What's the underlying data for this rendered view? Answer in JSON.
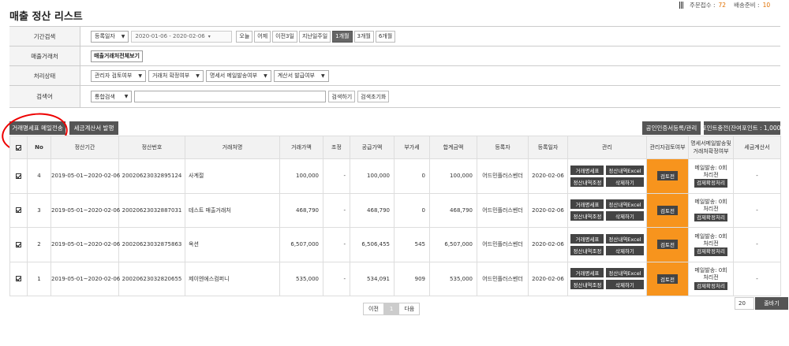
{
  "page_title": "매출 정산 리스트",
  "status": {
    "order_label": "주문접수 :",
    "order_count": "72",
    "ship_label": "배송준비 :",
    "ship_count": "10"
  },
  "search": {
    "period": {
      "label": "기간검색",
      "type_select": "등록일자",
      "date_range": "2020-01-06 - 2020-02-06",
      "quick_buttons": [
        "오늘",
        "어제",
        "이전3일",
        "지난일주일",
        "1개월",
        "3개월",
        "6개월"
      ],
      "active_quick": "1개월"
    },
    "partner": {
      "label": "매출거래처",
      "button": "매출거래처전체보기"
    },
    "status_filter": {
      "label": "처리상태",
      "selects": [
        "관리자 검토여부",
        "거래처 확정여부",
        "명세서 메일발송여부",
        "계산서 발급여부"
      ]
    },
    "keyword": {
      "label": "검색어",
      "select": "통합검색",
      "value": "",
      "search_button": "검색하기",
      "reset_button": "검색초기화"
    }
  },
  "actions": {
    "send_statement": "거래명세표 메일전송",
    "issue_invoice": "세금계산서 발행",
    "cert_register": "공인인증서등록/관리",
    "point_charge": "포인트충전(잔여포인트 : 1,000)"
  },
  "table": {
    "headers": [
      "No",
      "정산기간",
      "정산번호",
      "거래처명",
      "거래가액",
      "조정",
      "공급가액",
      "부가세",
      "합계금액",
      "등록자",
      "등록일자",
      "관리",
      "관리자검토여부",
      "명세서메일발송및 거래처확정여부",
      "세금계산서"
    ],
    "manage_buttons": [
      "거래명세표",
      "정산내역Excel",
      "정산내역조정",
      "삭제하기"
    ],
    "review_button": "검토전",
    "tax_status": "메일발송: 0회",
    "tax_status2": "처리전",
    "tax_button": "검제확정처리",
    "rows": [
      {
        "no": "4",
        "period": "2019-05-01~2020-02-06",
        "settle_no": "20020623032895124",
        "partner": "사계절",
        "trade_amount": "100,000",
        "adjust": "-",
        "supply": "100,000",
        "vat": "0",
        "total": "100,000",
        "registrant": "어드민플러스벤더",
        "reg_date": "2020-02-06",
        "invoice": "-"
      },
      {
        "no": "3",
        "period": "2019-05-01~2020-02-06",
        "settle_no": "20020623032887031",
        "partner": "테스트 매출거래처",
        "trade_amount": "468,790",
        "adjust": "-",
        "supply": "468,790",
        "vat": "0",
        "total": "468,790",
        "registrant": "어드민플러스벤더",
        "reg_date": "2020-02-06",
        "invoice": "-"
      },
      {
        "no": "2",
        "period": "2019-05-01~2020-02-06",
        "settle_no": "20020623032875863",
        "partner": "옥션",
        "trade_amount": "6,507,000",
        "adjust": "-",
        "supply": "6,506,455",
        "vat": "545",
        "total": "6,507,000",
        "registrant": "어드민플러스벤더",
        "reg_date": "2020-02-06",
        "invoice": "-"
      },
      {
        "no": "1",
        "period": "2019-05-01~2020-02-06",
        "settle_no": "20020623032820655",
        "partner": "제이엔에스컴퍼니",
        "trade_amount": "535,000",
        "adjust": "-",
        "supply": "534,091",
        "vat": "909",
        "total": "535,000",
        "registrant": "어드민플러스벤더",
        "reg_date": "2020-02-06",
        "invoice": "-"
      }
    ]
  },
  "pagination": {
    "prev": "이전",
    "current": "1",
    "next": "다음"
  },
  "per_page": {
    "value": "20",
    "button": "줄바기"
  }
}
